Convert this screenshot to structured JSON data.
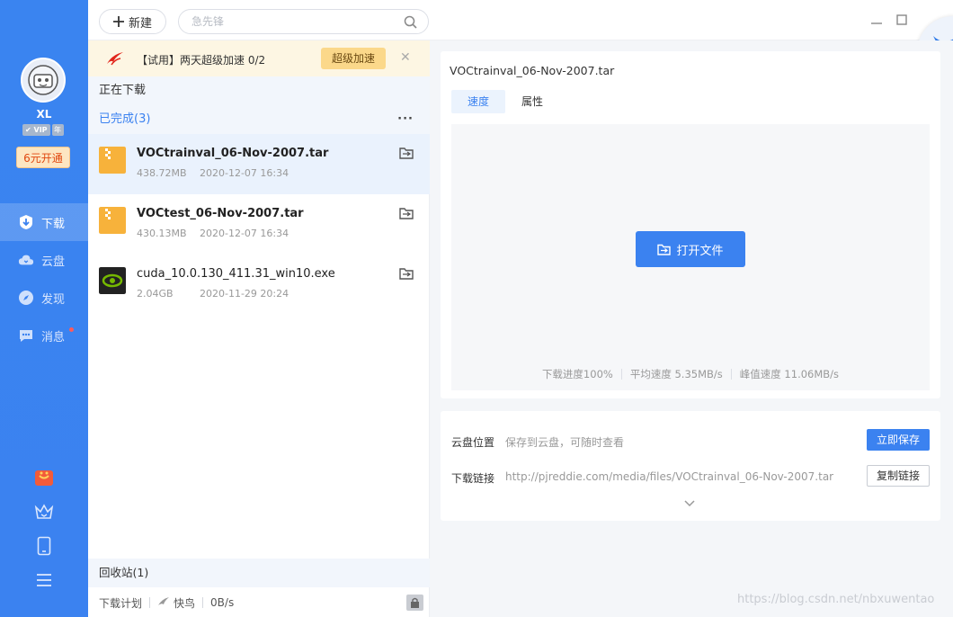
{
  "user": {
    "name": "XL",
    "vip_label": "VIP",
    "vip_year": "年",
    "open_vip": "6元开通"
  },
  "nav": [
    {
      "label": "下载",
      "icon": "download-icon"
    },
    {
      "label": "云盘",
      "icon": "cloud-icon"
    },
    {
      "label": "发现",
      "icon": "compass-icon"
    },
    {
      "label": "消息",
      "icon": "message-icon"
    }
  ],
  "topbar": {
    "new_label": "新建",
    "search_placeholder": "急先锋"
  },
  "promo": {
    "text": "【试用】两天超级加速 0/2",
    "button": "超级加速"
  },
  "sections": {
    "downloading": "正在下载",
    "completed": "已完成(3)",
    "trash": "回收站(1)"
  },
  "files": [
    {
      "name": "VOCtrainval_06-Nov-2007.tar",
      "size": "438.72MB",
      "date": "2020-12-07 16:34"
    },
    {
      "name": "VOCtest_06-Nov-2007.tar",
      "size": "430.13MB",
      "date": "2020-12-07 16:34"
    },
    {
      "name": "cuda_10.0.130_411.31_win10.exe",
      "size": "2.04GB",
      "date": "2020-11-29 20:24"
    }
  ],
  "footer": {
    "plan": "下载计划",
    "mode": "快鸟",
    "speed": "0B/s"
  },
  "detail": {
    "title": "VOCtrainval_06-Nov-2007.tar",
    "tabs": [
      "速度",
      "属性"
    ],
    "open_button": "打开文件",
    "progress": "下载进度100%",
    "avg_speed": "平均速度 5.35MB/s",
    "peak_speed": "峰值速度 11.06MB/s",
    "cloud_label": "云盘位置",
    "cloud_value": "保存到云盘，可随时查看",
    "save_button": "立即保存",
    "link_label": "下载链接",
    "link_value": "http://pjreddie.com/media/files/VOCtrainval_06-Nov-2007.tar",
    "copy_button": "复制链接"
  },
  "watermark": "https://blog.csdn.net/nbxuwentao",
  "colors": {
    "accent": "#3b82f0",
    "sidebar": "#3a84f0",
    "promo_bg": "#fdf6e3",
    "folder": "#f7b23b"
  }
}
